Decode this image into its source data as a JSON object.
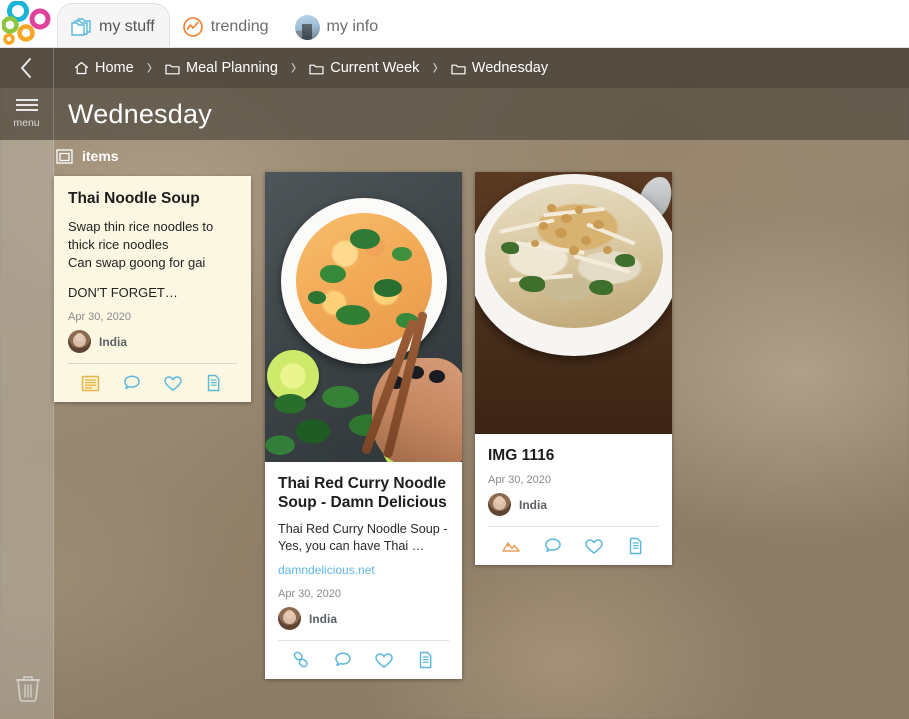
{
  "topbar": {
    "logo_name": "colored-rings-logo",
    "tabs": [
      {
        "label": "my stuff",
        "icon": "folders-icon",
        "active": true
      },
      {
        "label": "trending",
        "icon": "trending-icon",
        "active": false
      },
      {
        "label": "my info",
        "icon": "user-avatar",
        "active": false
      }
    ]
  },
  "breadcrumb": {
    "back_label": "back",
    "separator": "›",
    "items": [
      {
        "label": "Home",
        "icon": "home-icon"
      },
      {
        "label": "Meal Planning",
        "icon": "folder-icon"
      },
      {
        "label": "Current Week",
        "icon": "folder-icon"
      },
      {
        "label": "Wednesday",
        "icon": "folder-icon"
      }
    ]
  },
  "titlebar": {
    "menu_label": "menu",
    "title": "Wednesday"
  },
  "section": {
    "label": "items",
    "icon": "items-window-icon"
  },
  "rail": {
    "trash_label": "trash"
  },
  "cards": [
    {
      "type": "note",
      "title": "Thai Noodle Soup",
      "body": "Swap thin rice noodles to thick rice noodles\nCan swap goong for gai",
      "secondary": "DON'T FORGET…",
      "date": "Apr 30, 2020",
      "author": "India",
      "actions": [
        {
          "name": "note-icon",
          "color": "#e8b54b"
        },
        {
          "name": "comment-icon",
          "color": "#5bb8dd"
        },
        {
          "name": "heart-icon",
          "color": "#5bb8dd"
        },
        {
          "name": "copy-icon",
          "color": "#5bb8dd"
        }
      ]
    },
    {
      "type": "link",
      "thumb": "thai-red-curry-noodle-soup-photo",
      "title": "Thai Red Curry Noodle Soup - Damn Delicious",
      "description": "Thai Red Curry Noodle Soup - Yes, you can have Thai …",
      "url": "damndelicious.net",
      "date": "Apr 30, 2020",
      "author": "India",
      "actions": [
        {
          "name": "link-icon",
          "color": "#5bb8dd"
        },
        {
          "name": "comment-icon",
          "color": "#5bb8dd"
        },
        {
          "name": "heart-icon",
          "color": "#5bb8dd"
        },
        {
          "name": "copy-icon",
          "color": "#5bb8dd"
        }
      ]
    },
    {
      "type": "image",
      "thumb": "noodle-bowl-photo",
      "title": "IMG 1116",
      "date": "Apr 30, 2020",
      "author": "India",
      "actions": [
        {
          "name": "image-icon",
          "color": "#e8a15a"
        },
        {
          "name": "comment-icon",
          "color": "#5bb8dd"
        },
        {
          "name": "heart-icon",
          "color": "#5bb8dd"
        },
        {
          "name": "copy-icon",
          "color": "#5bb8dd"
        }
      ]
    }
  ],
  "colors": {
    "accent_teal": "#5bb8dd",
    "accent_orange": "#e8a15a",
    "note_bg": "#fbf7e3",
    "link_blue": "#62b6e3"
  }
}
